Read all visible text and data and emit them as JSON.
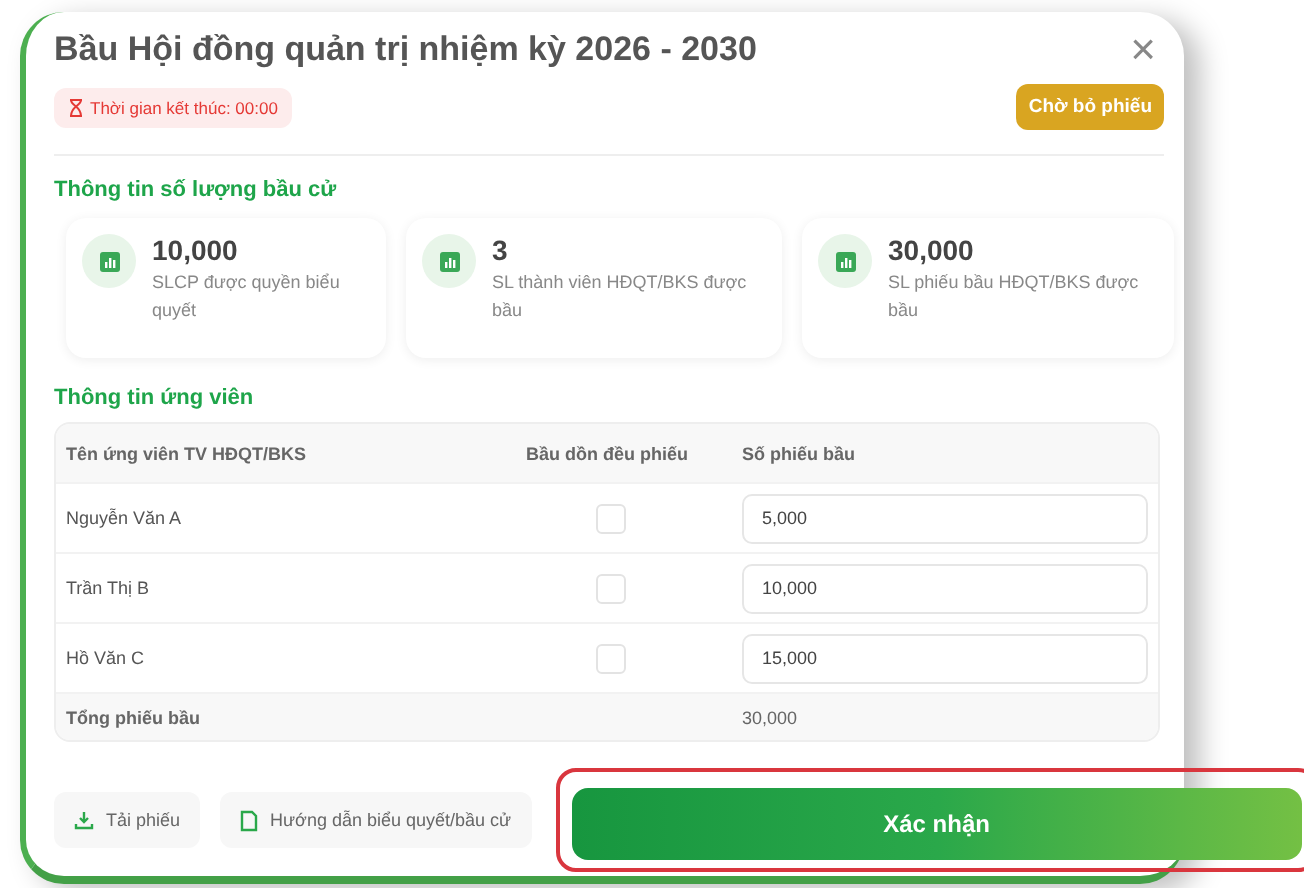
{
  "dialog": {
    "title": "Bầu Hội đồng quản trị nhiệm kỳ 2026 - 2030",
    "close": "×",
    "timer": "Thời gian kết thúc: 00:00",
    "status": "Chờ bỏ phiếu"
  },
  "stats_section": {
    "title": "Thông tin số lượng bầu cử",
    "items": [
      {
        "value": "10,000",
        "label": "SLCP được quyền biểu quyết"
      },
      {
        "value": "3",
        "label": "SL thành viên HĐQT/BKS được bầu"
      },
      {
        "value": "30,000",
        "label": "SL phiếu bầu HĐQT/BKS được bầu"
      }
    ]
  },
  "candidates": {
    "title": "Thông tin ứng viên",
    "columns": [
      "Tên ứng viên TV HĐQT/BKS",
      "Bầu dồn đều phiếu",
      "Số phiếu bầu"
    ],
    "rows": [
      {
        "name": "Nguyễn Văn A",
        "checked": false,
        "votes": "5,000"
      },
      {
        "name": "Trần Thị B",
        "checked": false,
        "votes": "10,000"
      },
      {
        "name": "Hồ Văn C",
        "checked": false,
        "votes": "15,000"
      }
    ],
    "total_label": "Tổng phiếu bầu",
    "total": "30,000"
  },
  "footer": {
    "download": "Tải phiếu",
    "guide": "Hướng dẫn biểu quyết/bầu cử",
    "confirm": "Xác nhận",
    "confirm_highlighted": true
  }
}
